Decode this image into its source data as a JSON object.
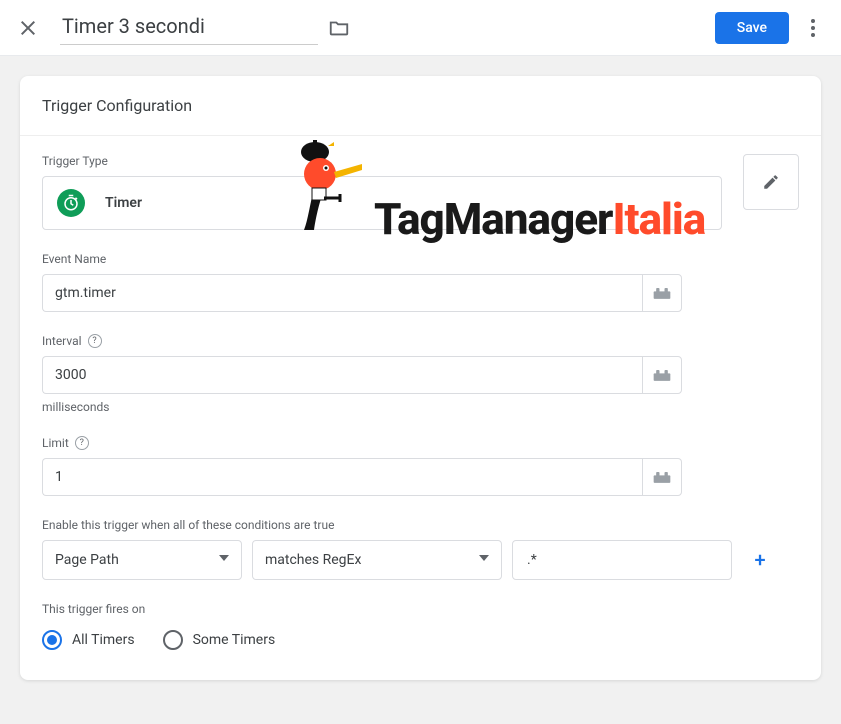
{
  "header": {
    "title": "Timer 3 secondi",
    "save_label": "Save"
  },
  "panel": {
    "title": "Trigger Configuration",
    "trigger_type": {
      "label": "Trigger Type",
      "name": "Timer"
    },
    "event_name": {
      "label": "Event Name",
      "value": "gtm.timer"
    },
    "interval": {
      "label": "Interval",
      "value": "3000",
      "unit": "milliseconds"
    },
    "limit": {
      "label": "Limit",
      "value": "1"
    },
    "conditions": {
      "label": "Enable this trigger when all of these conditions are true",
      "variable": "Page Path",
      "operator": "matches RegEx",
      "value": ".*"
    },
    "fires_on": {
      "label": "This trigger fires on",
      "options": [
        "All Timers",
        "Some Timers"
      ],
      "selected": "All Timers"
    }
  },
  "logo": {
    "part1": "TagManager",
    "part2": "Italia"
  }
}
